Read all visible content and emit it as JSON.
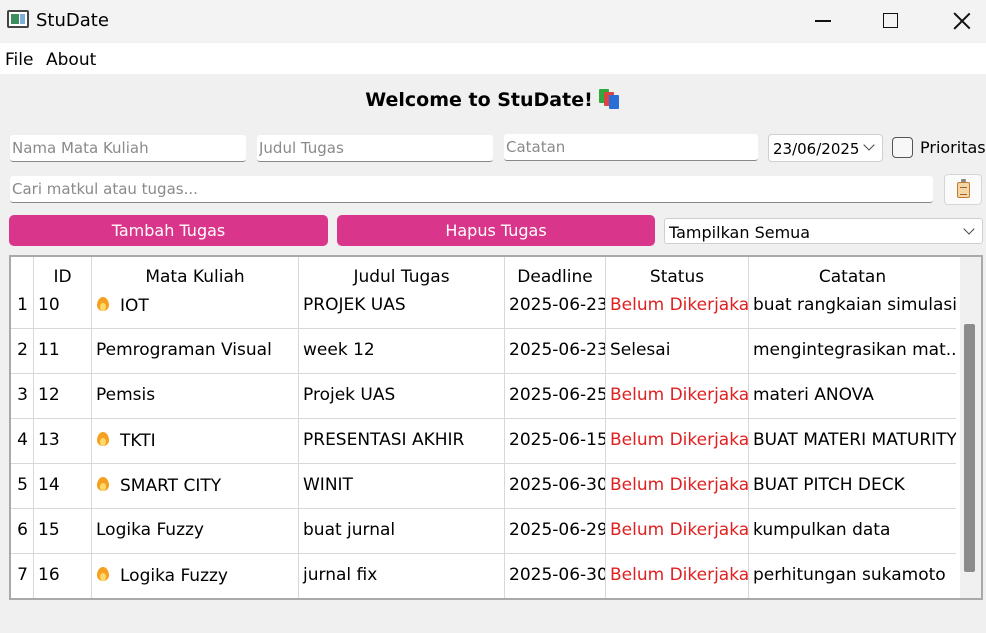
{
  "window": {
    "title": "StuDate"
  },
  "menu": {
    "file": "File",
    "about": "About"
  },
  "welcome": "Welcome to StuDate!",
  "form": {
    "mata_kuliah_placeholder": "Nama Mata Kuliah",
    "judul_placeholder": "Judul Tugas",
    "catatan_placeholder": "Catatan",
    "date_value": "23/06/2025",
    "prioritas_label": "Prioritas",
    "prioritas_checked": false,
    "search_placeholder": "Cari matkul atau tugas..."
  },
  "buttons": {
    "tambah": "Tambah Tugas",
    "hapus": "Hapus Tugas"
  },
  "filter": {
    "selected": "Tampilkan Semua"
  },
  "colors": {
    "accent": "#d9358a",
    "pending": "#e02020"
  },
  "table": {
    "headers": [
      "ID",
      "Mata Kuliah",
      "Judul Tugas",
      "Deadline",
      "Status",
      "Catatan"
    ],
    "rows": [
      {
        "num": "1",
        "id": "10",
        "matkul": "IOT",
        "priority": true,
        "judul": "PROJEK UAS",
        "deadline": "2025-06-23",
        "status": "Belum Dikerjakan",
        "catatan": "buat rangkaian simulasi"
      },
      {
        "num": "2",
        "id": "11",
        "matkul": "Pemrograman Visual",
        "priority": false,
        "judul": "week 12",
        "deadline": "2025-06-23",
        "status": "Selesai",
        "catatan": "mengintegrasikan mat..."
      },
      {
        "num": "3",
        "id": "12",
        "matkul": "Pemsis",
        "priority": false,
        "judul": "Projek UAS",
        "deadline": "2025-06-25",
        "status": "Belum Dikerjakan",
        "catatan": "materi ANOVA"
      },
      {
        "num": "4",
        "id": "13",
        "matkul": "TKTI",
        "priority": true,
        "judul": "PRESENTASI AKHIR",
        "deadline": "2025-06-15",
        "status": "Belum Dikerjakan",
        "catatan": "BUAT MATERI MATURITY"
      },
      {
        "num": "5",
        "id": "14",
        "matkul": "SMART CITY",
        "priority": true,
        "judul": "WINIT",
        "deadline": "2025-06-30",
        "status": "Belum Dikerjakan",
        "catatan": "BUAT PITCH DECK"
      },
      {
        "num": "6",
        "id": "15",
        "matkul": "Logika Fuzzy",
        "priority": false,
        "judul": "buat jurnal",
        "deadline": "2025-06-29",
        "status": "Belum Dikerjakan",
        "catatan": "kumpulkan data"
      },
      {
        "num": "7",
        "id": "16",
        "matkul": "Logika Fuzzy",
        "priority": true,
        "judul": "jurnal fix",
        "deadline": "2025-06-30",
        "status": "Belum Dikerjakan",
        "catatan": "perhitungan sukamoto"
      }
    ]
  }
}
